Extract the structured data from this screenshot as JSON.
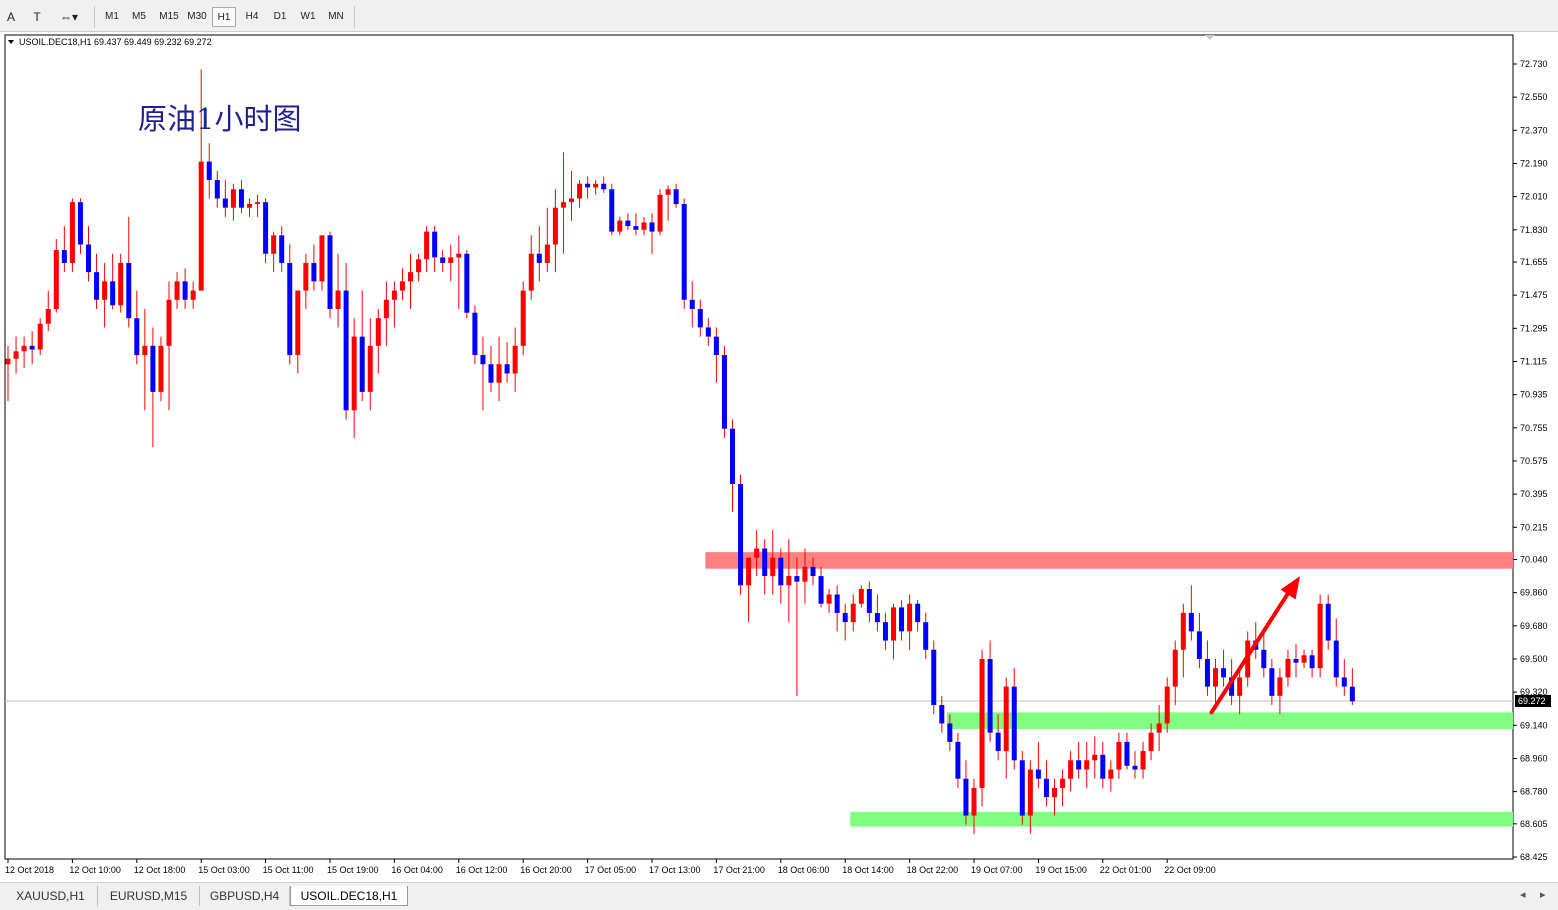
{
  "toolbar": {
    "tools": [
      {
        "name": "text-tool-button",
        "label": "A"
      },
      {
        "name": "text-label-tool-button",
        "label": "T"
      },
      {
        "name": "arrow-tool-button",
        "label": "⇔▾"
      }
    ],
    "timeframes": [
      "M1",
      "M5",
      "M15",
      "M30",
      "H1",
      "H4",
      "D1",
      "W1",
      "MN"
    ],
    "active_timeframe": "H1"
  },
  "tabs": [
    "XAUUSD,H1",
    "EURUSD,M15",
    "GBPUSD,H4",
    "USOIL.DEC18,H1"
  ],
  "active_tab": "USOIL.DEC18,H1",
  "colors": {
    "up": "#ff0000",
    "down": "#0000ff",
    "wick": "#ff0000",
    "resistance": "#ff8080",
    "support": "#80ff80",
    "arrow": "#ff0000",
    "annotation": "#20208f",
    "border": "#000000"
  },
  "chart_data": {
    "type": "candlestick",
    "symbol_header": "USOIL.DEC18,H1  69.437 69.449 69.232 69.272",
    "annotation": "原油1小时图",
    "current_price": 69.272,
    "current_price_label": "69.272",
    "ylim": [
      68.425,
      72.82
    ],
    "y_ticks": [
      "72.730",
      "72.550",
      "72.370",
      "72.190",
      "72.010",
      "71.830",
      "71.655",
      "71.475",
      "71.295",
      "71.115",
      "70.935",
      "70.755",
      "70.575",
      "70.395",
      "70.215",
      "70.040",
      "69.860",
      "69.680",
      "69.500",
      "69.320",
      "69.140",
      "68.960",
      "68.780",
      "68.605",
      "68.425"
    ],
    "x_tick_labels": [
      {
        "i": 0,
        "label": "12 Oct 2018"
      },
      {
        "i": 8,
        "label": "12 Oct 10:00"
      },
      {
        "i": 16,
        "label": "12 Oct 18:00"
      },
      {
        "i": 24,
        "label": "15 Oct 03:00"
      },
      {
        "i": 32,
        "label": "15 Oct 11:00"
      },
      {
        "i": 40,
        "label": "15 Oct 19:00"
      },
      {
        "i": 48,
        "label": "16 Oct 04:00"
      },
      {
        "i": 56,
        "label": "16 Oct 12:00"
      },
      {
        "i": 64,
        "label": "16 Oct 20:00"
      },
      {
        "i": 72,
        "label": "17 Oct 05:00"
      },
      {
        "i": 80,
        "label": "17 Oct 13:00"
      },
      {
        "i": 88,
        "label": "17 Oct 21:00"
      },
      {
        "i": 96,
        "label": "18 Oct 06:00"
      },
      {
        "i": 104,
        "label": "18 Oct 14:00"
      },
      {
        "i": 112,
        "label": "18 Oct 22:00"
      },
      {
        "i": 120,
        "label": "19 Oct 07:00"
      },
      {
        "i": 128,
        "label": "19 Oct 15:00"
      },
      {
        "i": 136,
        "label": "22 Oct 01:00"
      },
      {
        "i": 144,
        "label": "22 Oct 09:00"
      }
    ],
    "candle_count_visible": 187,
    "zones": [
      {
        "type": "resistance",
        "start_index": 87,
        "low": 69.99,
        "high": 70.08
      },
      {
        "type": "support",
        "start_index": 117,
        "low": 69.12,
        "high": 69.21
      },
      {
        "type": "support",
        "start_index": 105,
        "low": 68.59,
        "high": 68.67
      }
    ],
    "arrow": {
      "from_index": 149.5,
      "from_price": 69.21,
      "to_index": 160.5,
      "to_price": 69.95
    },
    "ohlc": [
      [
        71.1,
        71.2,
        70.9,
        71.13
      ],
      [
        71.13,
        71.25,
        71.05,
        71.17
      ],
      [
        71.17,
        71.25,
        71.08,
        71.2
      ],
      [
        71.2,
        71.28,
        71.1,
        71.18
      ],
      [
        71.18,
        71.35,
        71.15,
        71.32
      ],
      [
        71.32,
        71.5,
        71.28,
        71.4
      ],
      [
        71.4,
        71.78,
        71.38,
        71.72
      ],
      [
        71.72,
        71.85,
        71.6,
        71.65
      ],
      [
        71.65,
        72.0,
        71.6,
        71.98
      ],
      [
        71.98,
        72.0,
        71.7,
        71.75
      ],
      [
        71.75,
        71.85,
        71.55,
        71.6
      ],
      [
        71.6,
        71.7,
        71.4,
        71.45
      ],
      [
        71.45,
        71.65,
        71.3,
        71.55
      ],
      [
        71.55,
        71.7,
        71.4,
        71.42
      ],
      [
        71.42,
        71.7,
        71.38,
        71.65
      ],
      [
        71.65,
        71.9,
        71.3,
        71.35
      ],
      [
        71.35,
        71.5,
        71.1,
        71.15
      ],
      [
        71.15,
        71.4,
        70.85,
        71.2
      ],
      [
        71.2,
        71.3,
        70.65,
        70.95
      ],
      [
        70.95,
        71.25,
        70.9,
        71.2
      ],
      [
        71.2,
        71.55,
        70.85,
        71.45
      ],
      [
        71.45,
        71.6,
        71.4,
        71.55
      ],
      [
        71.55,
        71.62,
        71.4,
        71.45
      ],
      [
        71.45,
        71.55,
        71.4,
        71.5
      ],
      [
        71.5,
        72.7,
        71.8,
        72.2
      ],
      [
        72.2,
        72.3,
        72.0,
        72.1
      ],
      [
        72.1,
        72.15,
        71.95,
        72.0
      ],
      [
        72.0,
        72.1,
        71.9,
        71.95
      ],
      [
        71.95,
        72.08,
        71.88,
        72.05
      ],
      [
        72.05,
        72.1,
        71.92,
        71.95
      ],
      [
        71.95,
        72.0,
        71.9,
        71.97
      ],
      [
        71.97,
        72.02,
        71.9,
        71.98
      ],
      [
        71.98,
        72.0,
        71.65,
        71.7
      ],
      [
        71.7,
        71.82,
        71.6,
        71.8
      ],
      [
        71.8,
        71.85,
        71.6,
        71.65
      ],
      [
        71.65,
        71.75,
        71.1,
        71.15
      ],
      [
        71.15,
        71.5,
        71.05,
        71.5
      ],
      [
        71.5,
        71.7,
        71.4,
        71.65
      ],
      [
        71.65,
        71.75,
        71.5,
        71.55
      ],
      [
        71.55,
        71.8,
        71.5,
        71.8
      ],
      [
        71.8,
        71.82,
        71.35,
        71.4
      ],
      [
        71.4,
        71.7,
        71.3,
        71.5
      ],
      [
        71.5,
        71.65,
        70.8,
        70.85
      ],
      [
        70.85,
        71.35,
        70.7,
        71.25
      ],
      [
        71.25,
        71.5,
        70.9,
        70.95
      ],
      [
        70.95,
        71.35,
        70.85,
        71.2
      ],
      [
        71.2,
        71.4,
        71.05,
        71.35
      ],
      [
        71.35,
        71.55,
        71.2,
        71.45
      ],
      [
        71.45,
        71.55,
        71.3,
        71.5
      ],
      [
        71.5,
        71.62,
        71.45,
        71.55
      ],
      [
        71.55,
        71.7,
        71.4,
        71.6
      ],
      [
        71.6,
        71.7,
        71.55,
        71.67
      ],
      [
        71.67,
        71.85,
        71.6,
        71.82
      ],
      [
        71.82,
        71.85,
        71.6,
        71.68
      ],
      [
        71.68,
        71.72,
        71.6,
        71.65
      ],
      [
        71.65,
        71.75,
        71.55,
        71.68
      ],
      [
        71.68,
        71.8,
        71.4,
        71.7
      ],
      [
        71.7,
        71.72,
        71.35,
        71.38
      ],
      [
        71.38,
        71.42,
        71.1,
        71.15
      ],
      [
        71.15,
        71.25,
        70.85,
        71.1
      ],
      [
        71.1,
        71.2,
        70.95,
        71.0
      ],
      [
        71.0,
        71.25,
        70.9,
        71.1
      ],
      [
        71.1,
        71.22,
        71.0,
        71.05
      ],
      [
        71.05,
        71.3,
        70.95,
        71.2
      ],
      [
        71.2,
        71.55,
        71.15,
        71.5
      ],
      [
        71.5,
        71.8,
        71.45,
        71.7
      ],
      [
        71.7,
        71.85,
        71.55,
        71.65
      ],
      [
        71.65,
        71.95,
        71.6,
        71.75
      ],
      [
        71.75,
        72.05,
        71.6,
        71.95
      ],
      [
        71.95,
        72.25,
        71.7,
        71.98
      ],
      [
        71.98,
        72.15,
        71.88,
        72.0
      ],
      [
        72.0,
        72.1,
        71.95,
        72.08
      ],
      [
        72.08,
        72.12,
        72.0,
        72.06
      ],
      [
        72.06,
        72.1,
        72.02,
        72.08
      ],
      [
        72.08,
        72.12,
        72.03,
        72.05
      ],
      [
        72.05,
        72.08,
        71.8,
        71.82
      ],
      [
        71.82,
        71.9,
        71.8,
        71.88
      ],
      [
        71.88,
        71.92,
        71.83,
        71.85
      ],
      [
        71.85,
        71.92,
        71.8,
        71.83
      ],
      [
        71.83,
        71.9,
        71.8,
        71.87
      ],
      [
        71.87,
        71.92,
        71.7,
        71.82
      ],
      [
        71.82,
        72.05,
        71.8,
        72.02
      ],
      [
        72.02,
        72.07,
        71.88,
        72.05
      ],
      [
        72.05,
        72.08,
        71.95,
        71.97
      ],
      [
        71.97,
        72.0,
        71.4,
        71.45
      ],
      [
        71.45,
        71.55,
        71.3,
        71.4
      ],
      [
        71.4,
        71.45,
        71.25,
        71.3
      ],
      [
        71.3,
        71.35,
        71.2,
        71.25
      ],
      [
        71.25,
        71.3,
        71.0,
        71.15
      ],
      [
        71.15,
        71.2,
        70.7,
        70.75
      ],
      [
        70.75,
        70.8,
        70.3,
        70.45
      ],
      [
        70.45,
        70.5,
        69.85,
        69.9
      ],
      [
        69.9,
        70.05,
        69.7,
        70.05
      ],
      [
        70.05,
        70.2,
        69.95,
        70.1
      ],
      [
        70.1,
        70.15,
        69.85,
        69.95
      ],
      [
        69.95,
        70.2,
        69.85,
        70.05
      ],
      [
        70.05,
        70.1,
        69.8,
        69.9
      ],
      [
        69.9,
        70.15,
        69.7,
        69.95
      ],
      [
        69.95,
        70.05,
        69.3,
        69.92
      ],
      [
        69.92,
        70.1,
        69.8,
        70.0
      ],
      [
        70.0,
        70.05,
        69.9,
        69.95
      ],
      [
        69.95,
        70.0,
        69.78,
        69.8
      ],
      [
        69.8,
        69.88,
        69.75,
        69.85
      ],
      [
        69.85,
        69.9,
        69.65,
        69.75
      ],
      [
        69.75,
        69.8,
        69.6,
        69.7
      ],
      [
        69.7,
        69.85,
        69.65,
        69.8
      ],
      [
        69.8,
        69.9,
        69.78,
        69.88
      ],
      [
        69.88,
        69.92,
        69.7,
        69.75
      ],
      [
        69.75,
        69.85,
        69.65,
        69.7
      ],
      [
        69.7,
        69.75,
        69.55,
        69.6
      ],
      [
        69.6,
        69.8,
        69.5,
        69.78
      ],
      [
        69.78,
        69.82,
        69.6,
        69.65
      ],
      [
        69.65,
        69.85,
        69.55,
        69.8
      ],
      [
        69.8,
        69.82,
        69.65,
        69.7
      ],
      [
        69.7,
        69.75,
        69.5,
        69.55
      ],
      [
        69.55,
        69.6,
        69.2,
        69.25
      ],
      [
        69.25,
        69.3,
        69.1,
        69.15
      ],
      [
        69.15,
        69.2,
        69.0,
        69.05
      ],
      [
        69.05,
        69.1,
        68.8,
        68.85
      ],
      [
        68.85,
        68.95,
        68.6,
        68.65
      ],
      [
        68.65,
        68.85,
        68.55,
        68.8
      ],
      [
        68.8,
        69.55,
        68.7,
        69.5
      ],
      [
        69.5,
        69.6,
        69.05,
        69.1
      ],
      [
        69.1,
        69.2,
        68.95,
        69.0
      ],
      [
        69.0,
        69.4,
        68.85,
        69.35
      ],
      [
        69.35,
        69.45,
        68.9,
        68.95
      ],
      [
        68.95,
        69.0,
        68.6,
        68.65
      ],
      [
        68.65,
        68.95,
        68.55,
        68.9
      ],
      [
        68.9,
        69.05,
        68.8,
        68.85
      ],
      [
        68.85,
        68.95,
        68.7,
        68.75
      ],
      [
        68.75,
        68.85,
        68.65,
        68.8
      ],
      [
        68.8,
        68.9,
        68.7,
        68.85
      ],
      [
        68.85,
        69.0,
        68.78,
        68.95
      ],
      [
        68.95,
        69.05,
        68.85,
        68.9
      ],
      [
        68.9,
        69.05,
        68.8,
        68.95
      ],
      [
        68.95,
        69.08,
        68.85,
        68.98
      ],
      [
        68.98,
        69.05,
        68.8,
        68.85
      ],
      [
        68.85,
        68.95,
        68.78,
        68.9
      ],
      [
        68.9,
        69.1,
        68.85,
        69.05
      ],
      [
        69.05,
        69.1,
        68.9,
        68.92
      ],
      [
        68.92,
        69.0,
        68.85,
        68.9
      ],
      [
        68.9,
        69.05,
        68.85,
        69.0
      ],
      [
        69.0,
        69.15,
        68.95,
        69.1
      ],
      [
        69.1,
        69.25,
        69.0,
        69.15
      ],
      [
        69.15,
        69.4,
        69.1,
        69.35
      ],
      [
        69.35,
        69.6,
        69.25,
        69.55
      ],
      [
        69.55,
        69.8,
        69.4,
        69.75
      ],
      [
        69.75,
        69.9,
        69.6,
        69.65
      ],
      [
        69.65,
        69.75,
        69.45,
        69.5
      ],
      [
        69.5,
        69.6,
        69.3,
        69.35
      ],
      [
        69.35,
        69.5,
        69.25,
        69.45
      ],
      [
        69.45,
        69.55,
        69.35,
        69.4
      ],
      [
        69.4,
        69.5,
        69.25,
        69.3
      ],
      [
        69.3,
        69.45,
        69.2,
        69.4
      ],
      [
        69.4,
        69.65,
        69.35,
        69.6
      ],
      [
        69.6,
        69.7,
        69.5,
        69.55
      ],
      [
        69.55,
        69.65,
        69.4,
        69.45
      ],
      [
        69.45,
        69.5,
        69.25,
        69.3
      ],
      [
        69.3,
        69.45,
        69.2,
        69.4
      ],
      [
        69.4,
        69.55,
        69.35,
        69.5
      ],
      [
        69.5,
        69.58,
        69.4,
        69.48
      ],
      [
        69.48,
        69.55,
        69.45,
        69.52
      ],
      [
        69.52,
        69.55,
        69.4,
        69.45
      ],
      [
        69.45,
        69.85,
        69.4,
        69.8
      ],
      [
        69.8,
        69.85,
        69.55,
        69.6
      ],
      [
        69.6,
        69.72,
        69.35,
        69.4
      ],
      [
        69.4,
        69.5,
        69.3,
        69.35
      ],
      [
        69.35,
        69.45,
        69.25,
        69.27
      ]
    ]
  }
}
